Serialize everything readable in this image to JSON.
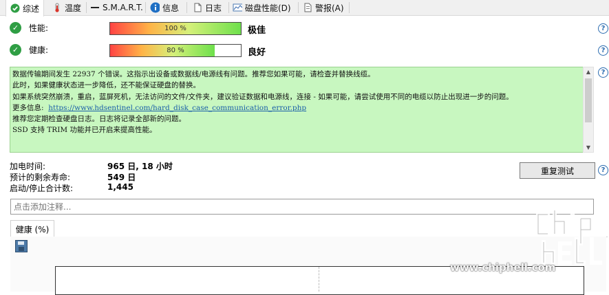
{
  "tabs": [
    {
      "label": "综述",
      "icon": "check-circle-icon",
      "active": true
    },
    {
      "label": "温度",
      "icon": "thermometer-icon"
    },
    {
      "label": "S.M.A.R.T.",
      "icon": "smart-dash-icon"
    },
    {
      "label": "信息",
      "icon": "info-icon"
    },
    {
      "label": "日志",
      "icon": "document-icon"
    },
    {
      "label": "磁盘性能(D)",
      "icon": "chart-icon"
    },
    {
      "label": "警报(A)",
      "icon": "alert-icon"
    }
  ],
  "performance": {
    "label": "性能:",
    "bar_text": "100 %",
    "value_fraction": 1.0,
    "status": "极佳"
  },
  "health": {
    "label": "健康:",
    "bar_text": "80 %",
    "value_fraction": 0.8,
    "status": "良好"
  },
  "message": {
    "lines": [
      "数据传输期间发生 22937 个错误。这指示出设备或数据线/电源线有问题。推荐您如果可能，请检查并替换线缆。",
      "此时，如果健康状态进一步降低，还不能保证硬盘的替换。",
      "如果系统突然崩溃，重启，蓝屏死机，无法访问的文件/文件夹，建议验证数据和电源线，连接 - 如果可能，请尝试使用不同的电缆以防止出现进一步的问题。"
    ],
    "more_info_label": "更多信息:",
    "more_info_link": "https://www.hdsentinel.com/hard_disk_case_communication_error.php",
    "lines_after": [
      "推荐您定期检查硬盘日志。日志将记录全部新的问题。",
      "SSD 支持 TRIM 功能并已开启来提高性能。"
    ]
  },
  "stats": {
    "power_on_label": "加电时间:",
    "power_on_value": "965 日, 18 小时",
    "remaining_label": "预计的剩余寿命:",
    "remaining_value": "549 日",
    "startstop_label": "启动/停止合计数:",
    "startstop_value": "1,445"
  },
  "retest_button": "重复测试",
  "comment": {
    "placeholder": "点击添加注释..."
  },
  "chart_tab": "健康 (%)",
  "watermark": {
    "logo": "chip hell",
    "url": "www.chiphell.com"
  },
  "colors": {
    "message_bg": "#c8f7c0",
    "link": "#1a5fa8",
    "check": "#2f9e44",
    "help": "#2b6cb0"
  }
}
